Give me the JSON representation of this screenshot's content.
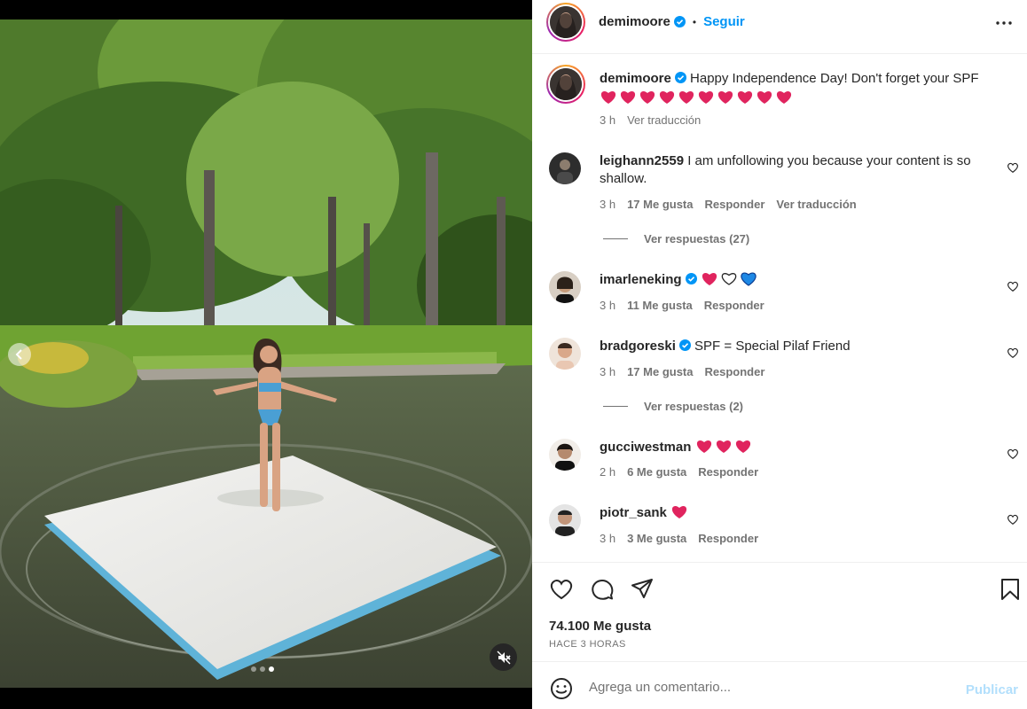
{
  "post": {
    "author": "demimoore",
    "follow_label": "Seguir",
    "separator": "•",
    "caption": {
      "username": "demimoore",
      "text": "Happy Independence Day! Don't forget your SPF",
      "time": "3 h",
      "translate": "Ver traducción"
    },
    "media": {
      "carousel_total": 3,
      "carousel_active": 3
    }
  },
  "comments": [
    {
      "username": "leighann2559",
      "text": "I am unfollowing you because your content is so",
      "text_line2": "shallow.",
      "time": "3 h",
      "likes": "17 Me gusta",
      "reply": "Responder",
      "translate": "Ver traducción",
      "replies": "Ver respuestas (27)"
    },
    {
      "username": "imarleneking",
      "hearts": [
        "red",
        "white",
        "blue"
      ],
      "time": "3 h",
      "likes": "11 Me gusta",
      "reply": "Responder"
    },
    {
      "username": "bradgoreski",
      "text": "SPF = Special Pilaf Friend",
      "time": "3 h",
      "likes": "17 Me gusta",
      "reply": "Responder",
      "replies": "Ver respuestas (2)"
    },
    {
      "username": "gucciwestman",
      "hearts": [
        "red",
        "red",
        "red"
      ],
      "time": "2 h",
      "likes": "6 Me gusta",
      "reply": "Responder"
    },
    {
      "username": "piotr_sank",
      "hearts": [
        "red"
      ],
      "time": "3 h",
      "likes": "3 Me gusta",
      "reply": "Responder"
    }
  ],
  "engagement": {
    "likes": "74.100 Me gusta",
    "time_ago": "HACE 3 HORAS"
  },
  "composer": {
    "placeholder": "Agrega un comentario...",
    "publish_label": "Publicar"
  },
  "colors": {
    "link_blue": "#0095f6",
    "publish_disabled": "#b2dffc",
    "muted_text": "#737373",
    "verified": "#0095f6",
    "heart_red": "#e0245e"
  },
  "icons": [
    "verified-badge-icon",
    "more-options-icon",
    "like-icon",
    "comment-icon",
    "share-icon",
    "bookmark-icon",
    "emoji-icon",
    "mute-icon",
    "chevron-left-icon"
  ]
}
